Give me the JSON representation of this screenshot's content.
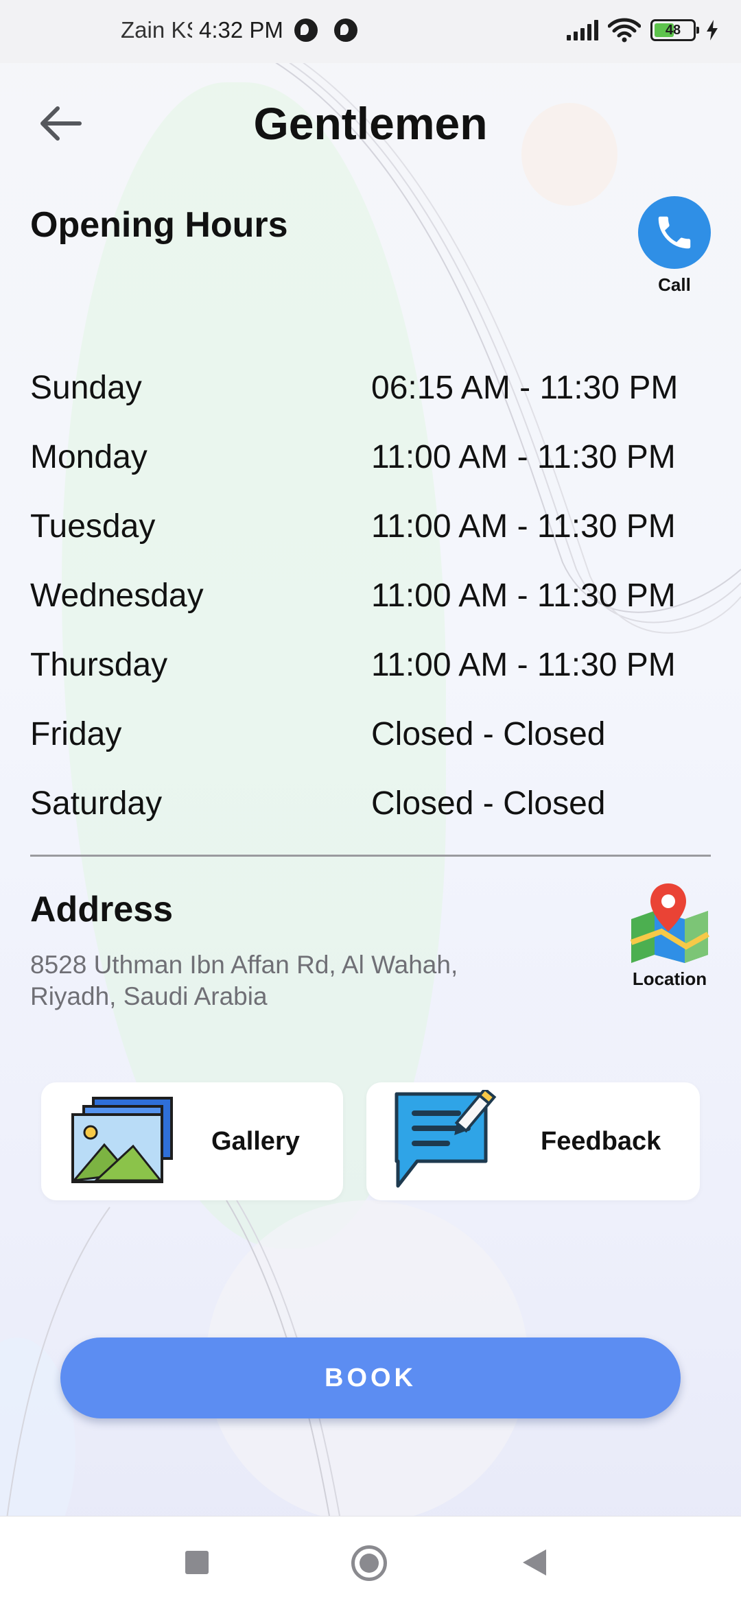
{
  "status_bar": {
    "carrier": "Zain KS",
    "time": "4:32 PM",
    "battery_level": "48"
  },
  "header": {
    "title": "Gentlemen",
    "back_icon": "arrow-left-icon"
  },
  "opening_hours": {
    "title": "Opening Hours",
    "call_label": "Call",
    "call_icon": "phone-icon",
    "rows": [
      {
        "day": "Sunday",
        "time": "06:15 AM - 11:30 PM"
      },
      {
        "day": "Monday",
        "time": "11:00 AM - 11:30 PM"
      },
      {
        "day": "Tuesday",
        "time": "11:00 AM - 11:30 PM"
      },
      {
        "day": "Wednesday",
        "time": "11:00 AM - 11:30 PM"
      },
      {
        "day": "Thursday",
        "time": "11:00 AM - 11:30 PM"
      },
      {
        "day": "Friday",
        "time": "Closed - Closed"
      },
      {
        "day": "Saturday",
        "time": "Closed - Closed"
      }
    ]
  },
  "address": {
    "title": "Address",
    "text": "8528 Uthman Ibn Affan Rd, Al Wahah, Riyadh, Saudi Arabia",
    "location_label": "Location",
    "location_icon": "map-pin-icon"
  },
  "cards": {
    "gallery": {
      "label": "Gallery",
      "icon": "gallery-icon"
    },
    "feedback": {
      "label": "Feedback",
      "icon": "feedback-icon"
    }
  },
  "book_button": {
    "label": "BOOK"
  },
  "colors": {
    "accent": "#5c8df2",
    "call": "#2f8fe6",
    "text": "#111111",
    "muted": "#6f6f75"
  }
}
